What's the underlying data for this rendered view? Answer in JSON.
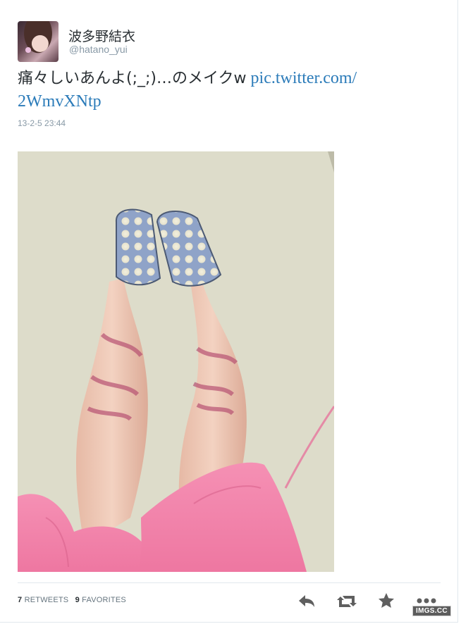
{
  "user": {
    "display_name": "波多野結衣",
    "screen_name": "@hatano_yui"
  },
  "tweet": {
    "text": "痛々しいあんよ(;_;)…のメイクw",
    "link_line1": "pic.twitter.com/",
    "link_line2": "2WmvXNtp",
    "timestamp": "13-2-5 23:44"
  },
  "stats": {
    "retweets_count": "7",
    "retweets_label": "RETWEETS",
    "favorites_count": "9",
    "favorites_label": "FAVORITES"
  },
  "icons": {
    "reply": "reply-icon",
    "retweet": "retweet-icon",
    "favorite": "star-icon",
    "more": "more-icon"
  },
  "colors": {
    "link": "#2b7bb9",
    "muted": "#8899a6",
    "text": "#292f33",
    "icon": "#66757f"
  },
  "watermark": {
    "text": "IMGS.CC"
  }
}
